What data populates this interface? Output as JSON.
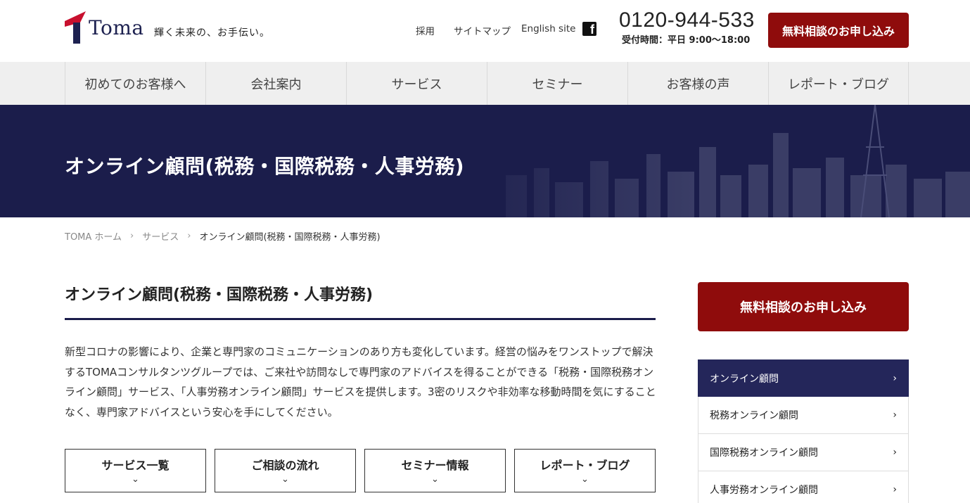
{
  "header": {
    "logo_text": "Toma",
    "tagline": "輝く未来の、お手伝い。",
    "top_links": [
      "採用",
      "サイトマップ",
      "English site"
    ],
    "facebook_icon": "facebook-icon",
    "phone": "0120-944-533",
    "hours": "受付時間：平日 9:00〜18:00",
    "cta_label": "無料相談のお申し込み"
  },
  "global_nav": [
    "初めてのお客様へ",
    "会社案内",
    "サービス",
    "セミナー",
    "お客様の声",
    "レポート・ブログ"
  ],
  "hero": {
    "title": "オンライン顧問(税務・国際税務・人事労務)"
  },
  "breadcrumb": [
    "TOMA ホーム",
    "サービス",
    "オンライン顧問(税務・国際税務・人事労務)"
  ],
  "main": {
    "title": "オンライン顧問(税務・国際税務・人事労務)",
    "intro": "新型コロナの影響により、企業と専門家のコミュニケーションのあり方も変化しています。経営の悩みをワンストップで解決するTOMAコンサルタンツグループでは、ご来社や訪問なしで専門家のアドバイスを得ることができる「税務・国際税務オンライン顧問」サービス、「人事労務オンライン顧問」サービスを提供します。3密のリスクや非効率な移動時間を気にすることなく、専門家アドバイスという安心を手にしてください。",
    "subnav": [
      "サービス一覧",
      "ご相談の流れ",
      "セミナー情報",
      "レポート・ブログ"
    ]
  },
  "sidebar": {
    "cta_label": "無料相談のお申し込み",
    "items": [
      "オンライン顧問",
      "税務オンライン顧問",
      "国際税務オンライン顧問",
      "人事労務オンライン顧問"
    ],
    "active_index": 0
  },
  "colors": {
    "brand_navy": "#1b1d4b",
    "cta_red": "#8f0c0c",
    "logo_red": "#c8102e"
  }
}
